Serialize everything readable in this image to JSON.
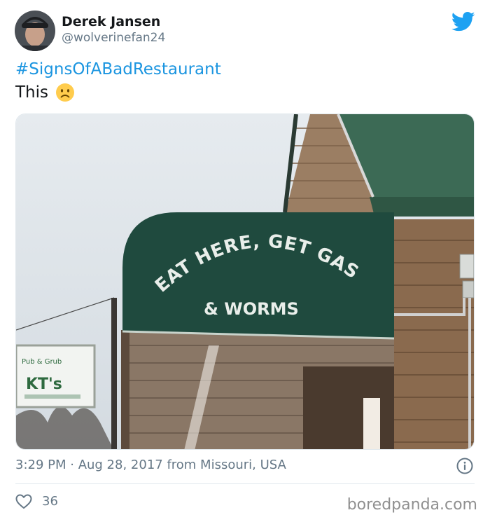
{
  "user": {
    "display_name": "Derek Jansen",
    "handle": "@wolverinefan24"
  },
  "tweet": {
    "hashtag": "#SignsOfABadRestaurant",
    "text": "This",
    "emoji": "slightly-frowning-face"
  },
  "photo": {
    "awning_top_text": "EAT HERE, GET GAS",
    "awning_bottom_text": "& WORMS",
    "sign_top": "Pub & Grub",
    "sign_name": "KT's"
  },
  "meta": {
    "timestamp": "3:29 PM · Aug 28, 2017 from Missouri, USA"
  },
  "actions": {
    "like_count": "36"
  },
  "watermark": "boredpanda.com",
  "colors": {
    "link": "#1b95e0",
    "muted": "#657786",
    "twitter_blue": "#1da1f2",
    "awning_green": "#1f4a3e",
    "roof_green": "#3c6a55"
  }
}
